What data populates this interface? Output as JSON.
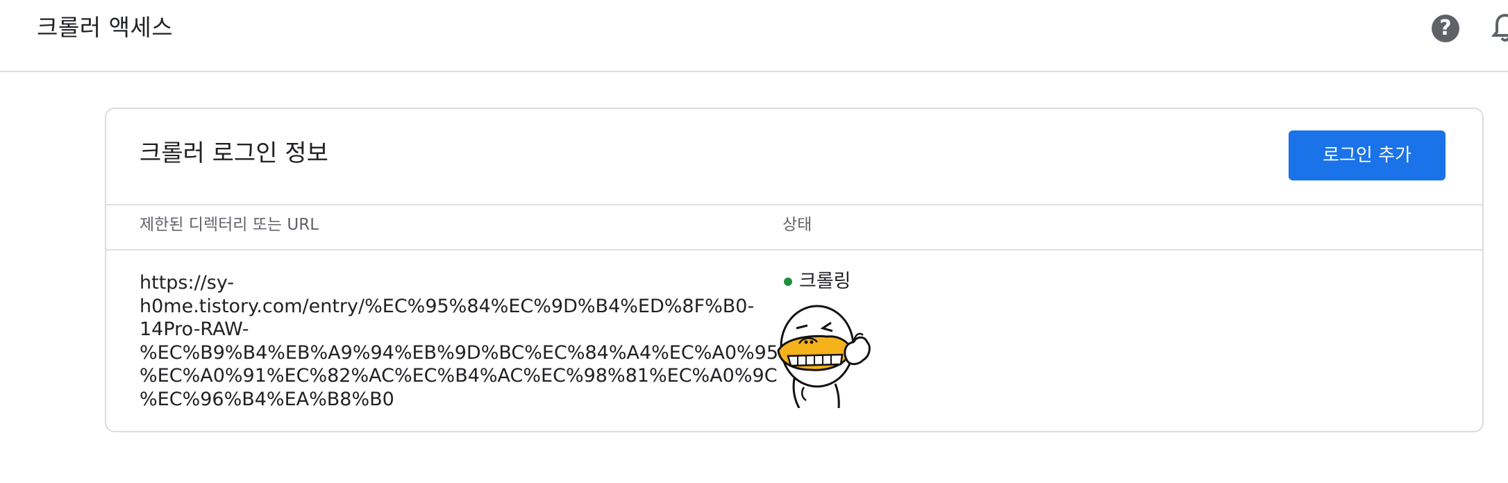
{
  "header": {
    "title": "크롤러 액세스",
    "help_icon": "help-circle-icon",
    "notifications_icon": "bell-icon"
  },
  "card": {
    "title": "크롤러 로그인 정보",
    "add_login_label": "로그인 추가",
    "columns": [
      "제한된 디렉터리 또는 URL",
      "상태"
    ],
    "rows": [
      {
        "url": "https://sy-\nh0me.tistory.com/entry/%EC%95%84%EC%9D%B4%ED%8F%B0-\n14Pro-RAW-\n%EC%B9%B4%EB%A9%94%EB%9D%BC%EC%84%A4%EC%A0%95-\n%EC%A0%91%EC%82%AC%EC%B4%AC%EC%98%81%EC%A0%9C\n%EC%96%B4%EA%B8%B0",
        "status": "크롤링",
        "status_color": "#1e8e3e"
      }
    ]
  },
  "colors": {
    "accent": "#1a73e8",
    "status_ok": "#1e8e3e"
  }
}
